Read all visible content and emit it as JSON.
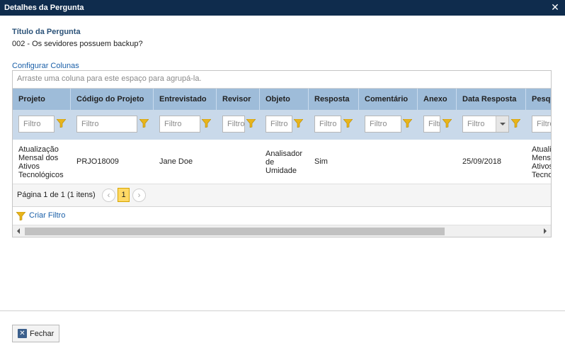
{
  "dialog": {
    "title": "Detalhes da Pergunta",
    "close_glyph": "✕"
  },
  "question": {
    "label": "Título da Pergunta",
    "text": "002 - Os sevidores possuem backup?"
  },
  "grid": {
    "config_link": "Configurar Colunas",
    "group_panel_hint": "Arraste uma coluna para este espaço para agrupá-la.",
    "columns": [
      "Projeto",
      "Código do Projeto",
      "Entrevistado",
      "Revisor",
      "Objeto",
      "Resposta",
      "Comentário",
      "Anexo",
      "Data Resposta",
      "Pesquisa"
    ],
    "filter_placeholder": "Filtro",
    "row": {
      "projeto": "Atualização Mensal dos Ativos Tecnológicos",
      "codigo": "PRJO18009",
      "entrevistado": "Jane Doe",
      "revisor": "",
      "objeto": "Analisador de Umidade",
      "resposta": "Sim",
      "comentario": "",
      "anexo": "",
      "data_resposta": "25/09/2018",
      "pesquisa": "Atualização Mensal dos Ativos Tecnológicos"
    },
    "pager": {
      "info": "Página 1 de 1 (1 itens)",
      "current_page": "1",
      "prev_glyph": "‹",
      "next_glyph": "›"
    },
    "filter_builder_label": "Criar Filtro"
  },
  "footer": {
    "close_button": "Fechar"
  },
  "colors": {
    "titlebar": "#0f2c4d",
    "header": "#9ebcd9",
    "filter_row": "#c9d9ea",
    "link": "#1a5fa8",
    "funnel": "#e8b51c"
  },
  "icons": {
    "close": "close-icon",
    "filter": "funnel-icon",
    "close_button": "close-x-icon"
  }
}
